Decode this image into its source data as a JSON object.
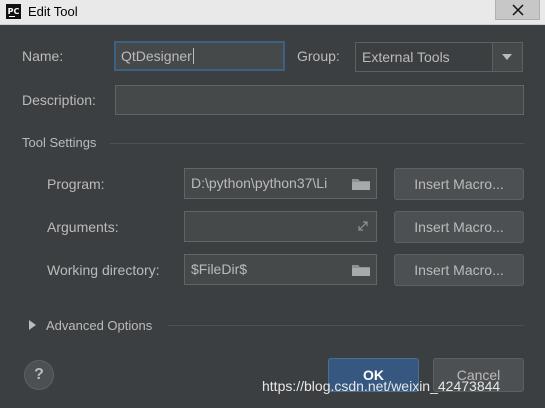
{
  "window": {
    "title": "Edit Tool",
    "app_icon_text": "PC",
    "close_icon": "close-icon"
  },
  "form": {
    "name_label": "Name:",
    "name_value": "QtDesigner",
    "group_label": "Group:",
    "group_value": "External Tools",
    "description_label": "Description:",
    "description_value": ""
  },
  "tool_settings": {
    "title": "Tool Settings",
    "program_label": "Program:",
    "program_value": "D:\\python\\python37\\Li",
    "arguments_label": "Arguments:",
    "arguments_value": "",
    "working_dir_label": "Working directory:",
    "working_dir_value": "$FileDir$",
    "insert_macro_label": "Insert Macro..."
  },
  "advanced": {
    "label": "Advanced Options"
  },
  "footer": {
    "help_label": "?",
    "ok_label": "OK",
    "cancel_label": "Cancel"
  },
  "watermark": "https://blog.csdn.net/weixin_42473844",
  "colors": {
    "background": "#3c3f41",
    "field_bg": "#45494a",
    "focus_border": "#3d6185",
    "primary_button": "#365880",
    "text": "#bbbbbb"
  }
}
